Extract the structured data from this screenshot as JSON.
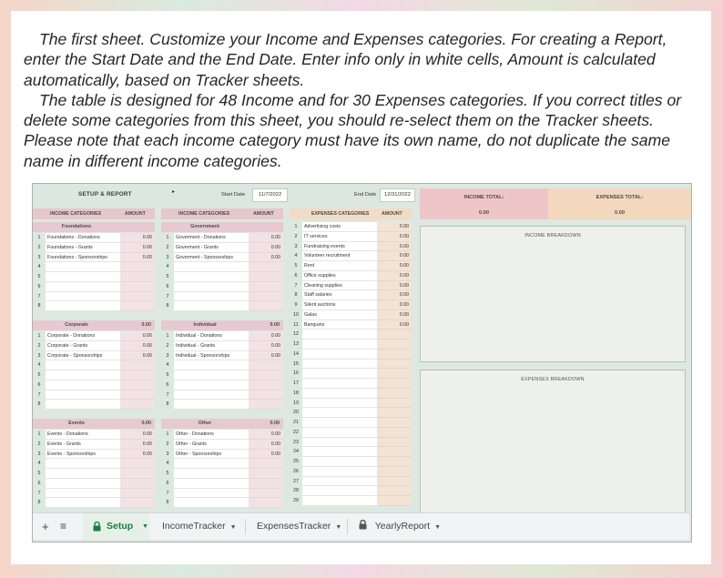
{
  "intro": {
    "paragraph1": "The first sheet. Customize your Income and Expenses categories. For creating a Report, enter the Start Date and the End Date. Enter info only in white cells, Amount is calculated automatically, based on Tracker sheets.",
    "paragraph2": "The table is designed for 48 Income and for 30 Expenses categories. If you correct titles or delete some categories from this sheet, you should re-select them on the Tracker sheets. Please note that each income category must have its own name, do not duplicate the same name in different income categories."
  },
  "sheet": {
    "title": "SETUP & REPORT",
    "start_date_label": "Start Date",
    "start_date": "11/7/2022",
    "end_date_label": "End Date",
    "end_date": "12/31/2022",
    "income_head": "INCOME CATEGORIES",
    "amount_head": "AMOUNT",
    "expenses_head": "EXPENSES CATEGORIES",
    "income_total_label": "INCOME TOTAL:",
    "income_total": "0.00",
    "expenses_total_label": "EXPENSES TOTAL:",
    "expenses_total": "0.00",
    "income_breakdown": "INCOME BREAKDOWN",
    "expenses_breakdown": "EXPENSES BREAKDOWN"
  },
  "groups": {
    "foundations": {
      "name": "Foundations",
      "amount": "",
      "rows": [
        "Foundations - Donations",
        "Foundations - Grants",
        "Foundations - Sponsorships",
        "",
        "",
        "",
        "",
        ""
      ],
      "amounts": [
        "0.00",
        "0.00",
        "0.00",
        "",
        "",
        "",
        "",
        ""
      ]
    },
    "government": {
      "name": "Government",
      "amount": "",
      "rows": [
        "Goverment - Donations",
        "Goverment - Grants",
        "Goverment - Sponsorships",
        "",
        "",
        "",
        "",
        ""
      ],
      "amounts": [
        "0.00",
        "0.00",
        "0.00",
        "",
        "",
        "",
        "",
        ""
      ]
    },
    "corporate": {
      "name": "Corporate",
      "amount": "0.00",
      "rows": [
        "Corporate - Donations",
        "Corporate - Grants",
        "Corporate - Sponsorships",
        "",
        "",
        "",
        "",
        ""
      ],
      "amounts": [
        "0.00",
        "0.00",
        "0.00",
        "",
        "",
        "",
        "",
        ""
      ]
    },
    "individual": {
      "name": "Individual",
      "amount": "0.00",
      "rows": [
        "Individual - Donations",
        "Individual - Grants",
        "Individual - Sponsorships",
        "",
        "",
        "",
        "",
        ""
      ],
      "amounts": [
        "0.00",
        "0.00",
        "0.00",
        "",
        "",
        "",
        "",
        ""
      ]
    },
    "events": {
      "name": "Events",
      "amount": "0.00",
      "rows": [
        "Events - Donations",
        "Events - Grants",
        "Events - Sponsorships",
        "",
        "",
        "",
        "",
        ""
      ],
      "amounts": [
        "0.00",
        "0.00",
        "0.00",
        "",
        "",
        "",
        "",
        ""
      ]
    },
    "other": {
      "name": "Other",
      "amount": "0.00",
      "rows": [
        "Other - Donations",
        "Other - Grants",
        "Other - Sponsorships",
        "",
        "",
        "",
        "",
        ""
      ],
      "amounts": [
        "0.00",
        "0.00",
        "0.00",
        "",
        "",
        "",
        "",
        ""
      ]
    }
  },
  "expenses": {
    "rows": [
      "Advertising costs",
      "IT services",
      "Fundraising events",
      "Volunteer recruitment",
      "Rent",
      "Office supplies",
      "Cleaning supplies",
      "Staff salaries",
      "Silent auctions",
      "Galas",
      "Banquets",
      "",
      "",
      "",
      "",
      "",
      "",
      "",
      "",
      "",
      "",
      "",
      "",
      "",
      "",
      "",
      "",
      "",
      ""
    ],
    "amounts": [
      "0.00",
      "0.00",
      "0.00",
      "0.00",
      "0.00",
      "0.00",
      "0.00",
      "0.00",
      "0.00",
      "0.00",
      "0.00",
      "",
      "",
      "",
      "",
      "",
      "",
      "",
      "",
      "",
      "",
      "",
      "",
      "",
      "",
      "",
      "",
      "",
      ""
    ]
  },
  "tabbar": {
    "add": "+",
    "menu": "≡",
    "tabs": [
      "Setup",
      "IncomeTracker",
      "ExpensesTracker",
      "YearlyReport"
    ],
    "active_color": "#188038"
  },
  "icons": [
    "plus-icon",
    "all-sheets-icon",
    "lock-icon",
    "caret-down-icon"
  ]
}
